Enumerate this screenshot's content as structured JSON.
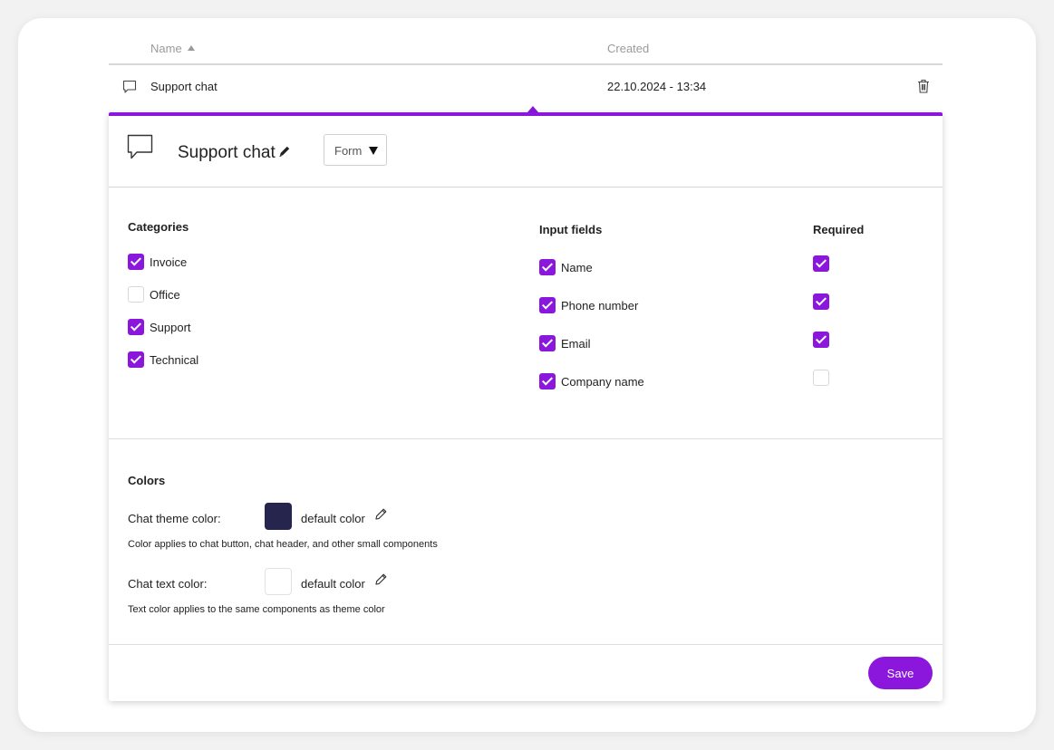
{
  "table": {
    "columns": {
      "name": "Name",
      "created": "Created"
    },
    "rows": [
      {
        "name": "Support chat",
        "created": "22.10.2024 - 13:34"
      }
    ]
  },
  "panel": {
    "title": "Support chat",
    "type_select": {
      "value": "Form"
    },
    "categories": {
      "heading": "Categories",
      "items": [
        {
          "label": "Invoice",
          "checked": true
        },
        {
          "label": "Office",
          "checked": false
        },
        {
          "label": "Support",
          "checked": true
        },
        {
          "label": "Technical",
          "checked": true
        }
      ]
    },
    "input_fields": {
      "heading": "Input fields",
      "required_heading": "Required",
      "items": [
        {
          "label": "Name",
          "checked": true,
          "required": true
        },
        {
          "label": "Phone number",
          "checked": true,
          "required": true
        },
        {
          "label": "Email",
          "checked": true,
          "required": true
        },
        {
          "label": "Company name",
          "checked": true,
          "required": false
        }
      ]
    },
    "colors": {
      "heading": "Colors",
      "theme": {
        "label": "Chat theme color:",
        "value_label": "default color",
        "swatch": "#25254e",
        "hint": "Color applies to chat button, chat header, and other small components"
      },
      "text": {
        "label": "Chat text color:",
        "value_label": "default color",
        "swatch": "#ffffff",
        "hint": "Text color applies to the same components as theme color"
      }
    },
    "save_label": "Save",
    "accent": "#8b17dc"
  }
}
